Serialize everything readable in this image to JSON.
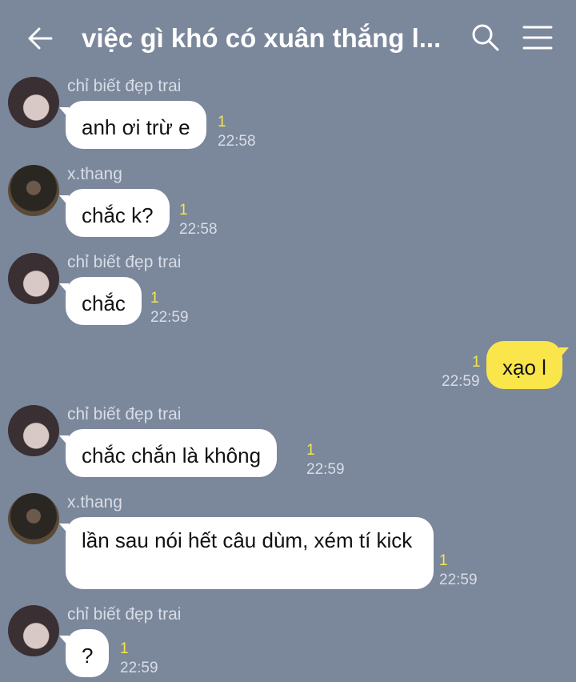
{
  "header": {
    "title": "việc gì khó có xuân thắng l...",
    "back_icon": "arrow-left-icon",
    "search_icon": "search-icon",
    "menu_icon": "hamburger-menu-icon"
  },
  "colors": {
    "background": "#7b879b",
    "incoming_bubble": "#ffffff",
    "outgoing_bubble": "#fae64b",
    "unread": "#f5e64a"
  },
  "messages": [
    {
      "sender": "chỉ biết đẹp trai",
      "text": "anh ơi trừ e",
      "unread": "1",
      "time": "22:58"
    },
    {
      "sender": "x.thang",
      "text": "chắc k?",
      "unread": "1",
      "time": "22:58"
    },
    {
      "sender": "chỉ biết đẹp trai",
      "text": "chắc",
      "unread": "1",
      "time": "22:59"
    },
    {
      "sender": "",
      "text": "xạo l",
      "unread": "1",
      "time": "22:59"
    },
    {
      "sender": "chỉ biết đẹp trai",
      "text": "chắc chắn là không",
      "unread": "1",
      "time": "22:59"
    },
    {
      "sender": "x.thang",
      "text": "lần sau nói hết câu dùm, xém tí kick",
      "unread": "1",
      "time": "22:59"
    },
    {
      "sender": "chỉ biết đẹp trai",
      "text": "?",
      "unread": "1",
      "time": "22:59"
    }
  ]
}
